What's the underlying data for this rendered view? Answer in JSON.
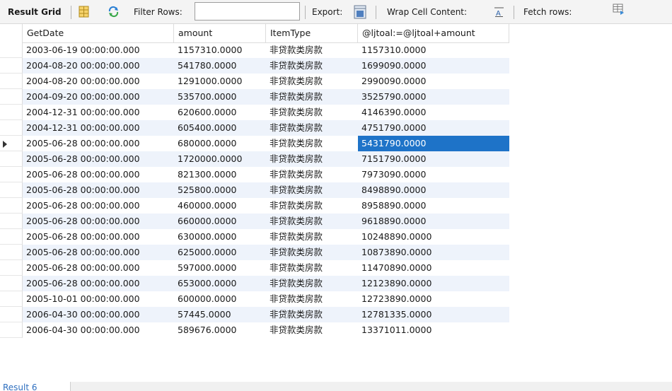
{
  "toolbar": {
    "result_grid_label": "Result Grid",
    "filter_rows_label": "Filter Rows:",
    "filter_value": "",
    "export_label": "Export:",
    "wrap_label": "Wrap Cell Content:",
    "fetch_label": "Fetch rows:"
  },
  "columns": [
    "GetDate",
    "amount",
    "ItemType",
    "@ljtoal:=@ljtoal+amount"
  ],
  "rows": [
    [
      "2003-06-19 00:00:00.000",
      "1157310.0000",
      "非贷款类房款",
      "1157310.0000"
    ],
    [
      "2004-08-20 00:00:00.000",
      "541780.0000",
      "非贷款类房款",
      "1699090.0000"
    ],
    [
      "2004-08-20 00:00:00.000",
      "1291000.0000",
      "非贷款类房款",
      "2990090.0000"
    ],
    [
      "2004-09-20 00:00:00.000",
      "535700.0000",
      "非贷款类房款",
      "3525790.0000"
    ],
    [
      "2004-12-31 00:00:00.000",
      "620600.0000",
      "非贷款类房款",
      "4146390.0000"
    ],
    [
      "2004-12-31 00:00:00.000",
      "605400.0000",
      "非贷款类房款",
      "4751790.0000"
    ],
    [
      "2005-06-28 00:00:00.000",
      "680000.0000",
      "非贷款类房款",
      "5431790.0000"
    ],
    [
      "2005-06-28 00:00:00.000",
      "1720000.0000",
      "非贷款类房款",
      "7151790.0000"
    ],
    [
      "2005-06-28 00:00:00.000",
      "821300.0000",
      "非贷款类房款",
      "7973090.0000"
    ],
    [
      "2005-06-28 00:00:00.000",
      "525800.0000",
      "非贷款类房款",
      "8498890.0000"
    ],
    [
      "2005-06-28 00:00:00.000",
      "460000.0000",
      "非贷款类房款",
      "8958890.0000"
    ],
    [
      "2005-06-28 00:00:00.000",
      "660000.0000",
      "非贷款类房款",
      "9618890.0000"
    ],
    [
      "2005-06-28 00:00:00.000",
      "630000.0000",
      "非贷款类房款",
      "10248890.0000"
    ],
    [
      "2005-06-28 00:00:00.000",
      "625000.0000",
      "非贷款类房款",
      "10873890.0000"
    ],
    [
      "2005-06-28 00:00:00.000",
      "597000.0000",
      "非贷款类房款",
      "11470890.0000"
    ],
    [
      "2005-06-28 00:00:00.000",
      "653000.0000",
      "非贷款类房款",
      "12123890.0000"
    ],
    [
      "2005-10-01 00:00:00.000",
      "600000.0000",
      "非贷款类房款",
      "12723890.0000"
    ],
    [
      "2006-04-30 00:00:00.000",
      "57445.0000",
      "非贷款类房款",
      "12781335.0000"
    ],
    [
      "2006-04-30 00:00:00.000",
      "589676.0000",
      "非贷款类房款",
      "13371011.0000"
    ]
  ],
  "selected_row": 6,
  "selected_col": 3,
  "bottom_tab_label": "Result 6",
  "colors": {
    "selection": "#1e73c8",
    "alt_row": "#eef3fb"
  }
}
